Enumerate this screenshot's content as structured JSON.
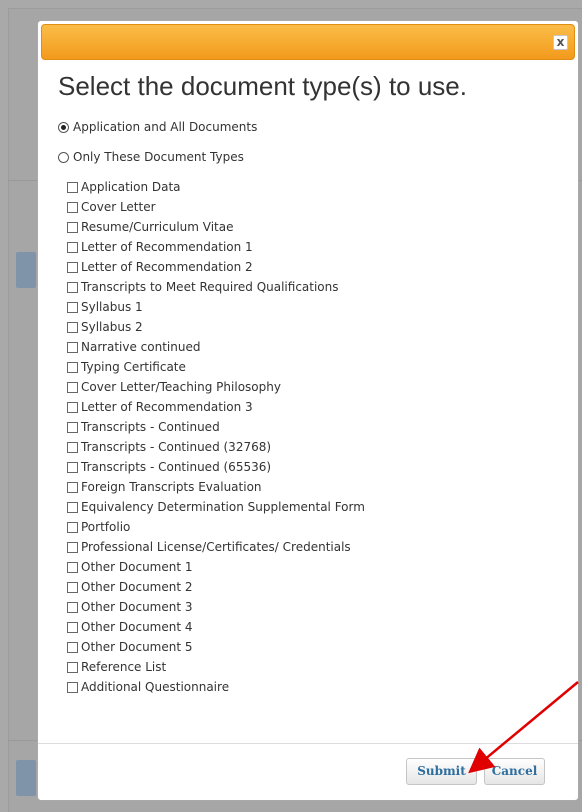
{
  "dialog": {
    "heading": "Select the document type(s) to use.",
    "close_label": "x",
    "options": [
      {
        "label": "Application and All Documents",
        "checked": true
      },
      {
        "label": "Only These Document Types",
        "checked": false
      }
    ],
    "document_types": [
      "Application Data",
      "Cover Letter",
      "Resume/Curriculum Vitae",
      "Letter of Recommendation 1",
      "Letter of Recommendation 2",
      "Transcripts to Meet Required Qualifications",
      "Syllabus 1",
      "Syllabus 2",
      "Narrative continued",
      "Typing Certificate",
      "Cover Letter/Teaching Philosophy",
      "Letter of Recommendation 3",
      "Transcripts - Continued",
      "Transcripts - Continued (32768)",
      "Transcripts - Continued (65536)",
      "Foreign Transcripts Evaluation",
      "Equivalency Determination Supplemental Form",
      "Portfolio",
      "Professional License/Certificates/ Credentials",
      "Other Document 1",
      "Other Document 2",
      "Other Document 3",
      "Other Document 4",
      "Other Document 5",
      "Reference List",
      "Additional Questionnaire"
    ],
    "buttons": {
      "submit": "Submit",
      "cancel": "Cancel"
    }
  },
  "colors": {
    "titlebar_top": "#fbbd48",
    "titlebar_bottom": "#f29a1c",
    "button_text": "#2e6e9e",
    "annotation_arrow": "#e00000"
  }
}
